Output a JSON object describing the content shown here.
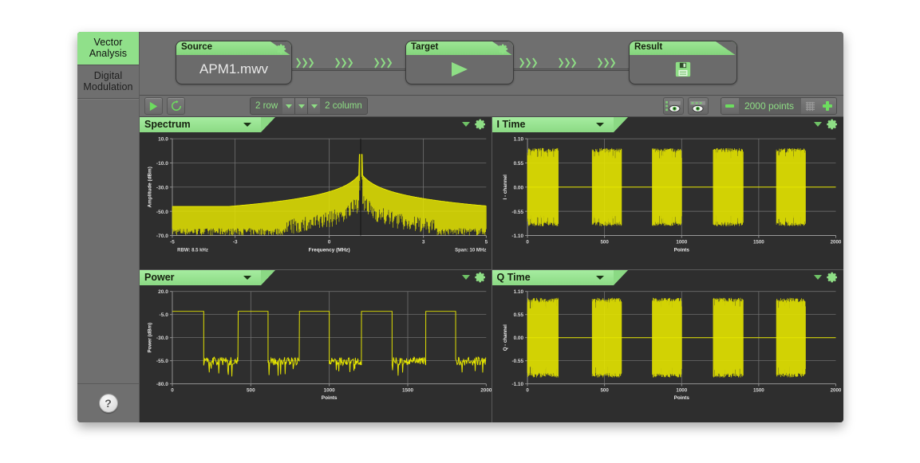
{
  "sidebar": {
    "tabs": [
      {
        "id": "vector-analysis",
        "label": "Vector\nAnalysis",
        "active": true
      },
      {
        "id": "digital-modulation",
        "label": "Digital\nModulation",
        "active": false
      }
    ],
    "help_label": "?"
  },
  "flow": {
    "source": {
      "title": "Source",
      "value": "APM1.mwv",
      "gear": "gear-icon"
    },
    "target": {
      "title": "Target",
      "value": "play-icon",
      "gear": "gear-icon"
    },
    "result": {
      "title": "Result",
      "value": "save-disk-icon"
    },
    "connector_glyph": "chevron-triple-right"
  },
  "toolbar": {
    "play_label": "play-icon",
    "loop_label": "refresh-loop-icon",
    "rows_value": "2",
    "rows_label": "row",
    "columns_value": "2",
    "columns_label": "column",
    "grid_text_left": "2 row",
    "grid_text_right": "2 column",
    "marker_eye_icon": "marker-visibility-icon",
    "trace_eye_icon": "trace-visibility-icon",
    "minus_label": "minus-icon",
    "points_value": "2000 points",
    "grid_icon": "grid-icon",
    "plus_label": "plus-icon"
  },
  "colors": {
    "accent_green": "#8bd984",
    "trace_yellow": "#e4e400",
    "panel_bg": "#2e2e2e",
    "chrome_gray": "#6f6f6f",
    "grid_line": "#777777"
  },
  "panels": [
    {
      "id": "spectrum",
      "title": "Spectrum"
    },
    {
      "id": "i-time",
      "title": "I Time"
    },
    {
      "id": "power",
      "title": "Power"
    },
    {
      "id": "q-time",
      "title": "Q Time"
    }
  ],
  "chart_data": [
    {
      "id": "spectrum",
      "type": "line",
      "title": "Spectrum",
      "xlabel": "Frequency (MHz)",
      "ylabel": "Amplitude (dBm)",
      "xlim": [
        -5,
        5
      ],
      "ylim": [
        -70,
        10
      ],
      "xticks": [
        "-5",
        "-3",
        "0",
        "3",
        "5"
      ],
      "xtick_values": [
        -5,
        -3,
        0,
        3,
        5
      ],
      "yticks": [
        "10.0",
        "-10.0",
        "-30.0",
        "-50.0",
        "-70.0"
      ],
      "ytick_values": [
        10,
        -10,
        -30,
        -50,
        -70
      ],
      "grid": true,
      "footer_left": "RBW: 8.5 kHz",
      "footer_right": "Span: 10 MHz",
      "marker_x": 1.0,
      "peak": {
        "x": 1.0,
        "y": -3.0
      },
      "noise_floor_dbm": -50,
      "description": "Broad noise floor near -50 dBm rising into a sharp carrier peak at about +1 MHz reaching roughly -3 dBm"
    },
    {
      "id": "i-time",
      "type": "line",
      "title": "I Time",
      "xlabel": "Points",
      "ylabel": "I - channel",
      "xlim": [
        0,
        2000
      ],
      "ylim": [
        -1.1,
        1.1
      ],
      "xticks": [
        "0",
        "500",
        "1000",
        "1500",
        "2000"
      ],
      "xtick_values": [
        0,
        500,
        1000,
        1500,
        2000
      ],
      "yticks": [
        "1.10",
        "0.55",
        "0.00",
        "-0.55",
        "-1.10"
      ],
      "ytick_values": [
        1.1,
        0.55,
        0.0,
        -0.55,
        -1.1
      ],
      "grid": true,
      "burst_amplitude": 0.87,
      "bursts": [
        [
          0,
          200
        ],
        [
          420,
          610
        ],
        [
          810,
          1000
        ],
        [
          1205,
          1400
        ],
        [
          1615,
          1805
        ]
      ],
      "description": "Five pulsed bursts of modulated I-channel samples with amplitude about +/-0.87 separated by zero gaps"
    },
    {
      "id": "power",
      "type": "line",
      "title": "Power",
      "xlabel": "Points",
      "ylabel": "Power (dBm)",
      "xlim": [
        0,
        2000
      ],
      "ylim": [
        -80,
        20
      ],
      "xticks": [
        "0",
        "500",
        "1000",
        "1500",
        "2000"
      ],
      "xtick_values": [
        0,
        500,
        1000,
        1500,
        2000
      ],
      "yticks": [
        "20.0",
        "-5.0",
        "-30.0",
        "-55.0",
        "-80.0"
      ],
      "ytick_values": [
        20,
        -5,
        -30,
        -55,
        -80
      ],
      "grid": true,
      "burst_level_dbm": -1.5,
      "off_level_dbm": -56,
      "bursts": [
        [
          0,
          200
        ],
        [
          420,
          610
        ],
        [
          810,
          1000
        ],
        [
          1205,
          1400
        ],
        [
          1615,
          1805
        ]
      ],
      "description": "Square pulsed power envelope at about -1.5 dBm during bursts dropping to a noisy -56 dBm floor between bursts"
    },
    {
      "id": "q-time",
      "type": "line",
      "title": "Q Time",
      "xlabel": "Points",
      "ylabel": "Q - channel",
      "xlim": [
        0,
        2000
      ],
      "ylim": [
        -1.1,
        1.1
      ],
      "xticks": [
        "0",
        "500",
        "1000",
        "1500",
        "2000"
      ],
      "xtick_values": [
        0,
        500,
        1000,
        1500,
        2000
      ],
      "yticks": [
        "1.10",
        "0.55",
        "0.00",
        "-0.55",
        "-1.10"
      ],
      "ytick_values": [
        1.1,
        0.55,
        0.0,
        -0.55,
        -1.1
      ],
      "grid": true,
      "burst_amplitude": 0.93,
      "bursts": [
        [
          0,
          200
        ],
        [
          420,
          610
        ],
        [
          810,
          1000
        ],
        [
          1205,
          1400
        ],
        [
          1615,
          1805
        ]
      ],
      "description": "Five pulsed bursts of modulated Q-channel samples with amplitude about +/-0.93 separated by zero gaps"
    }
  ]
}
